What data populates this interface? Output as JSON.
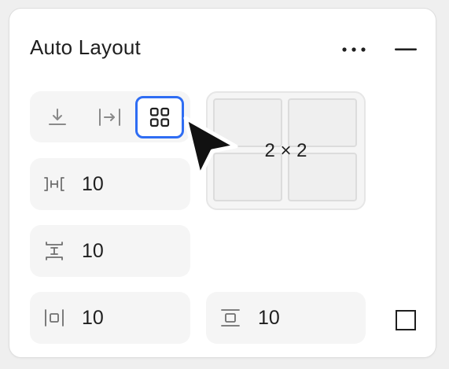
{
  "panel": {
    "title": "Auto Layout",
    "more_icon": "more-horizontal-icon",
    "collapse_icon": "minus-icon"
  },
  "direction": {
    "options": [
      {
        "id": "vertical",
        "icon": "arrow-down-to-line-icon",
        "active": false
      },
      {
        "id": "horizontal",
        "icon": "arrow-right-to-line-icon",
        "active": false
      },
      {
        "id": "grid",
        "icon": "grid-2x2-icon",
        "active": true
      }
    ],
    "accent_color": "#2f6df3"
  },
  "grid": {
    "label": "2 × 2",
    "rows": 2,
    "columns": 2
  },
  "fields": {
    "column_gap": {
      "icon": "horizontal-gap-icon",
      "value": "10"
    },
    "row_gap": {
      "icon": "vertical-gap-icon",
      "value": "10"
    },
    "padding_horizontal": {
      "icon": "horizontal-padding-icon",
      "value": "10"
    },
    "padding_vertical": {
      "icon": "vertical-padding-icon",
      "value": "10"
    }
  },
  "clip_icon": "clip-content-icon"
}
